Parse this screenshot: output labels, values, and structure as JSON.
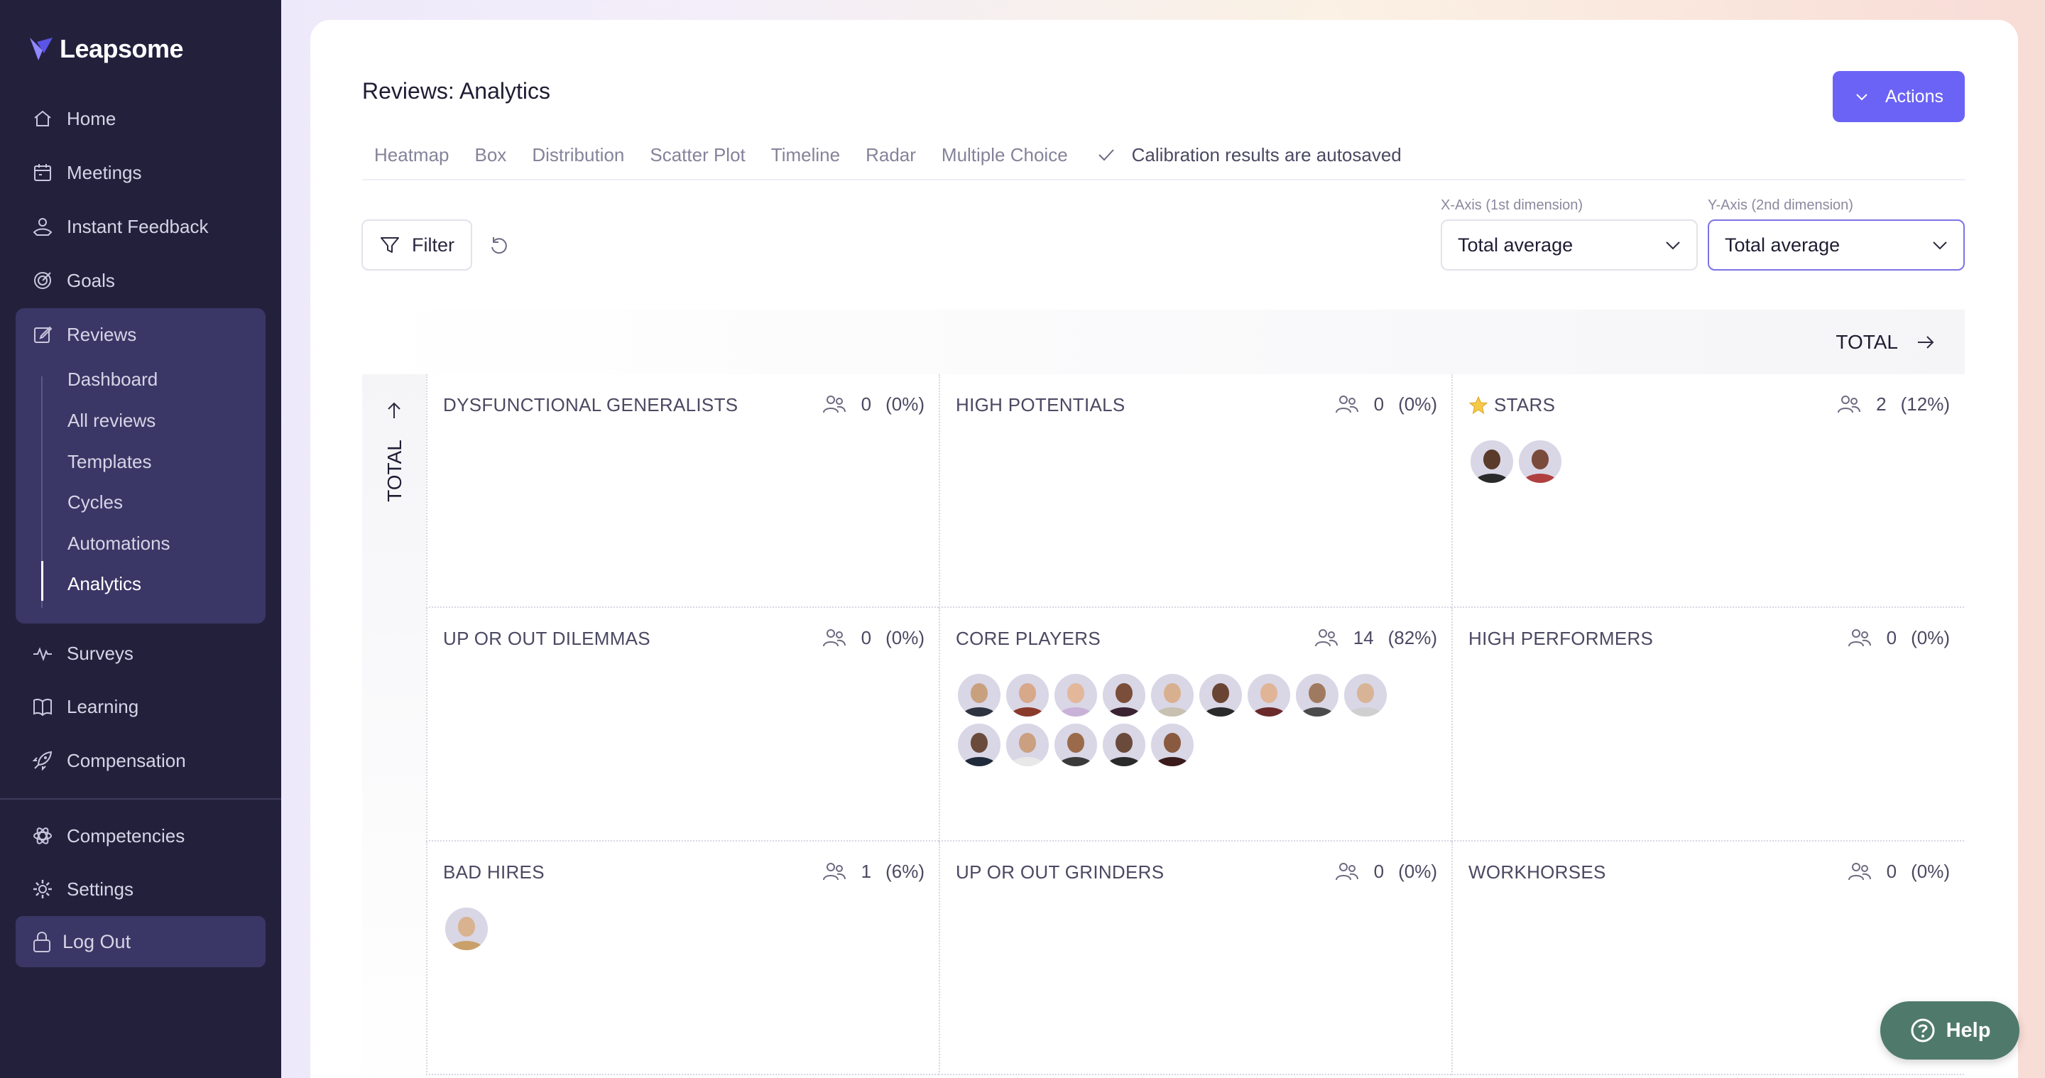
{
  "app": {
    "logo_text": "Leapsome"
  },
  "sidebar": {
    "items": [
      {
        "label": "Home",
        "icon": "home-icon"
      },
      {
        "label": "Meetings",
        "icon": "calendar-icon"
      },
      {
        "label": "Instant Feedback",
        "icon": "feedback-icon"
      },
      {
        "label": "Goals",
        "icon": "target-icon"
      },
      {
        "label": "Reviews",
        "icon": "edit-icon"
      },
      {
        "label": "Surveys",
        "icon": "pulse-icon"
      },
      {
        "label": "Learning",
        "icon": "book-icon"
      },
      {
        "label": "Compensation",
        "icon": "rocket-icon"
      },
      {
        "label": "Competencies",
        "icon": "atom-icon"
      },
      {
        "label": "Settings",
        "icon": "gear-icon"
      }
    ],
    "reviews_sub": [
      "Dashboard",
      "All reviews",
      "Templates",
      "Cycles",
      "Automations",
      "Analytics"
    ],
    "logout_label": "Log Out"
  },
  "page": {
    "title": "Reviews: Analytics",
    "actions_label": "Actions",
    "tabs": [
      "Heatmap",
      "Box",
      "Distribution",
      "Scatter Plot",
      "Timeline",
      "Radar",
      "Multiple Choice"
    ],
    "autosave_text": "Calibration results are autosaved",
    "filter_label": "Filter",
    "x_axis_label": "X-Axis (1st dimension)",
    "x_axis_value": "Total average",
    "y_axis_label": "Y-Axis (2nd dimension)",
    "y_axis_value": "Total average",
    "x_total_label": "TOTAL",
    "y_total_label": "TOTAL"
  },
  "grid": [
    {
      "title": "DYSFUNCTIONAL GENERALISTS",
      "count": "0",
      "pct": "(0%)",
      "avatars": []
    },
    {
      "title": "HIGH POTENTIALS",
      "count": "0",
      "pct": "(0%)",
      "avatars": []
    },
    {
      "title": "STARS",
      "count": "2",
      "pct": "(12%)",
      "star": true,
      "avatars": [
        {
          "skin": "#5a3a2a",
          "shirt": "#2a2a2a"
        },
        {
          "skin": "#7a4a3a",
          "shirt": "#b04040"
        }
      ]
    },
    {
      "title": "UP OR OUT DILEMMAS",
      "count": "0",
      "pct": "(0%)",
      "avatars": []
    },
    {
      "title": "CORE PLAYERS",
      "count": "14",
      "pct": "(82%)",
      "avatars": [
        {
          "skin": "#c9a07e",
          "shirt": "#2d3340"
        },
        {
          "skin": "#d8a88a",
          "shirt": "#8a3a2a"
        },
        {
          "skin": "#e2b79a",
          "shirt": "#c9b2d8"
        },
        {
          "skin": "#7a4e3a",
          "shirt": "#3a2230"
        },
        {
          "skin": "#d9b08f",
          "shirt": "#c8c0b0"
        },
        {
          "skin": "#6a4433",
          "shirt": "#2a2a2a"
        },
        {
          "skin": "#e0b496",
          "shirt": "#6a2a2a"
        },
        {
          "skin": "#a07a60",
          "shirt": "#4a4a4a"
        },
        {
          "skin": "#d8b496",
          "shirt": "#cfcfcf"
        },
        {
          "skin": "#6a4a3a",
          "shirt": "#1f2a3a"
        },
        {
          "skin": "#caa080",
          "shirt": "#e8e8e8"
        },
        {
          "skin": "#9a6a4a",
          "shirt": "#3a3a3a"
        },
        {
          "skin": "#6a4a3a",
          "shirt": "#2a2a2a"
        },
        {
          "skin": "#8a5a40",
          "shirt": "#3a1a1a"
        }
      ]
    },
    {
      "title": "HIGH PERFORMERS",
      "count": "0",
      "pct": "(0%)",
      "avatars": []
    },
    {
      "title": "BAD HIRES",
      "count": "1",
      "pct": "(6%)",
      "avatars": [
        {
          "skin": "#d9b28f",
          "shirt": "#c9a06a"
        }
      ]
    },
    {
      "title": "UP OR OUT GRINDERS",
      "count": "0",
      "pct": "(0%)",
      "avatars": []
    },
    {
      "title": "WORKHORSES",
      "count": "0",
      "pct": "(0%)",
      "avatars": []
    }
  ],
  "help_label": "Help",
  "colors": {
    "sidebar_bg": "#23203c",
    "accent": "#6b63f5",
    "help_bg": "#4f7a6b"
  }
}
